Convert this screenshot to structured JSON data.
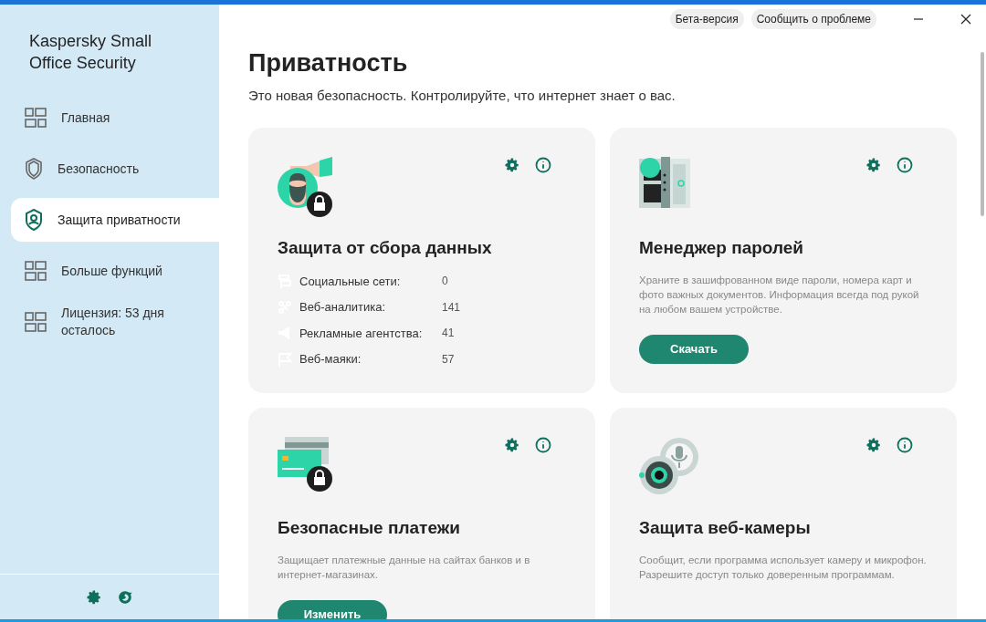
{
  "sidebar": {
    "app_title": "Kaspersky Small Office Security",
    "items": [
      {
        "label": "Главная",
        "selected": false
      },
      {
        "label": "Безопасность",
        "selected": false
      },
      {
        "label": "Защита приватности",
        "selected": true
      },
      {
        "label": "Больше функций",
        "selected": false
      },
      {
        "label": "Лицензия: 53 дня осталось",
        "selected": false
      }
    ]
  },
  "top_bar": {
    "links": [
      "Бета-версия",
      "Сообщить о проблеме"
    ]
  },
  "page": {
    "title": "Приватность",
    "subtitle": "Это новая безопасность. Контролируйте, что интернет знает о вас."
  },
  "cards": [
    {
      "kind": "stats",
      "title": "Защита от сбора данных",
      "stats": [
        {
          "label": "Социальные сети:",
          "value": "0"
        },
        {
          "label": "Веб-аналитика:",
          "value": "141"
        },
        {
          "label": "Рекламные агентства:",
          "value": "41"
        },
        {
          "label": "Веб-маяки:",
          "value": "57"
        }
      ]
    },
    {
      "kind": "description",
      "title": "Менеджер паролей",
      "description": "Храните в зашифрованном виде пароли, номера карт и фото важных документов. Информация всегда под рукой на любом вашем устройстве.",
      "button": "Скачать"
    },
    {
      "kind": "description",
      "title": "Безопасные платежи",
      "description": "Защищает платежные данные на сайтах банков и в интернет-магазинах.",
      "button": "Изменить"
    },
    {
      "kind": "description",
      "title": "Защита веб-камеры",
      "description": "Сообщит, если программа использует камеру и микрофон. Разрешите доступ только доверенным программам."
    }
  ]
}
